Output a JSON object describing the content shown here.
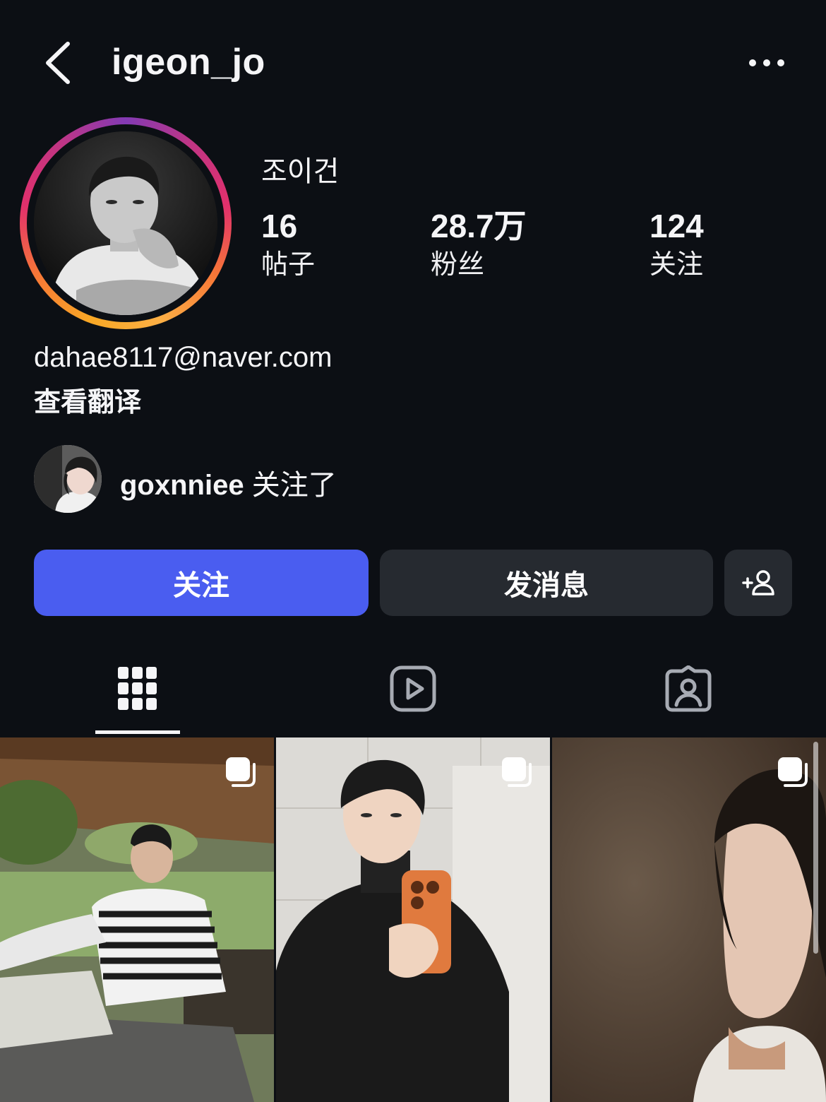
{
  "header": {
    "username": "igeon_jo",
    "back_icon": "chevron-left-icon",
    "more_icon": "ellipsis-icon"
  },
  "profile": {
    "display_name": "조이건",
    "stats": [
      {
        "value": "16",
        "label": "帖子"
      },
      {
        "value": "28.7万",
        "label": "粉丝"
      },
      {
        "value": "124",
        "label": "关注"
      }
    ],
    "bio_email": "dahae8117@naver.com",
    "translate_link": "查看翻译"
  },
  "followed_by": {
    "username": "goxnniee",
    "suffix": "关注了"
  },
  "actions": {
    "follow_label": "关注",
    "message_label": "发消息",
    "add_icon": "add-person-icon"
  },
  "tabs": [
    {
      "icon": "grid-icon",
      "active": true
    },
    {
      "icon": "reels-icon",
      "active": false
    },
    {
      "icon": "tagged-icon",
      "active": false
    }
  ],
  "colors": {
    "background": "#0c0f14",
    "follow_button": "#4a5df0",
    "secondary_button": "#262a30",
    "text": "#f5f5f7"
  }
}
